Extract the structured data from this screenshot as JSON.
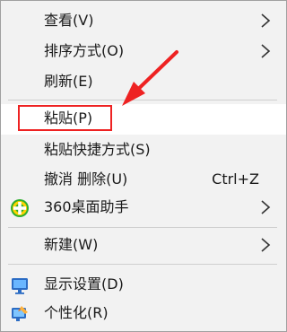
{
  "menu": {
    "view": {
      "label": "查看(V)",
      "icon": "chevron-right-icon"
    },
    "sort": {
      "label": "排序方式(O)",
      "icon": "chevron-right-icon"
    },
    "refresh": {
      "label": "刷新(E)"
    },
    "paste": {
      "label": "粘贴(P)"
    },
    "paste_shortcut": {
      "label": "粘贴快捷方式(S)"
    },
    "undo_delete": {
      "label": "撤消 删除(U)",
      "shortcut": "Ctrl+Z"
    },
    "desktop_helper": {
      "label": "360桌面助手",
      "icon": "360-desktop-icon"
    },
    "new": {
      "label": "新建(W)",
      "icon": "chevron-right-icon"
    },
    "display_settings": {
      "label": "显示设置(D)",
      "icon": "display-settings-icon"
    },
    "personalize": {
      "label": "个性化(R)",
      "icon": "personalize-icon"
    }
  },
  "annotation": {
    "highlight_color": "#ee2222",
    "target": "粘贴(P)"
  }
}
